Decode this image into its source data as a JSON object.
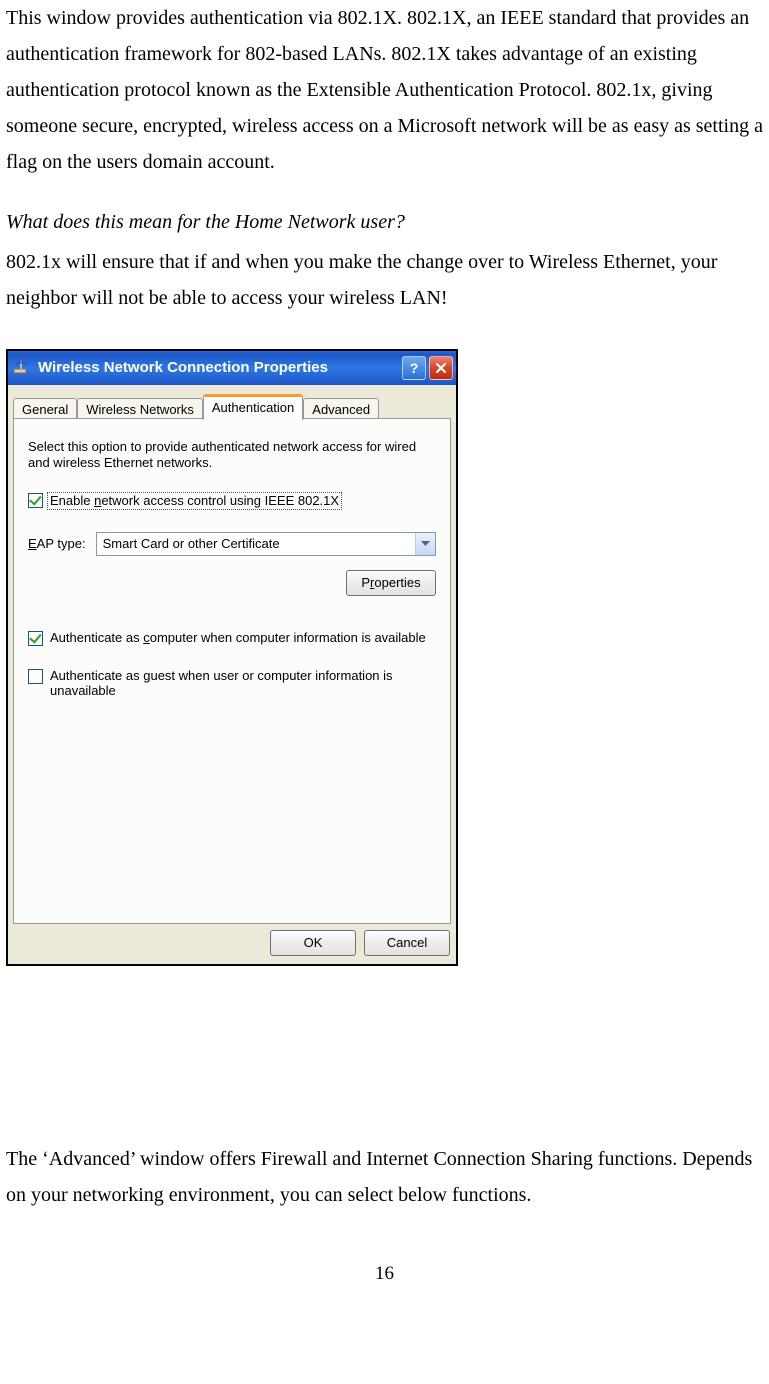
{
  "doc": {
    "para1": "This window provides authentication via 802.1X. 802.1X, an IEEE standard that provides an authentication framework for 802-based LANs. 802.1X takes advantage of an existing authentication protocol known as the Extensible Authentication Protocol. 802.1x, giving someone secure, encrypted, wireless access on a Microsoft network will be as easy as setting a flag on the users domain account.",
    "question": "What does this mean for the Home Network user?",
    "para2": "802.1x will ensure that if and when you make the change over to Wireless Ethernet, your neighbor will not be able to access your wireless LAN!",
    "para3": "The ‘Advanced’ window offers Firewall and Internet Connection Sharing functions. Depends on your networking environment, you can select below functions.",
    "page_number": "16"
  },
  "dialog": {
    "title": "Wireless Network Connection Properties",
    "tabs": {
      "general": "General",
      "wireless": "Wireless Networks",
      "auth": "Authentication",
      "advanced": "Advanced"
    },
    "description": "Select this option to provide authenticated network access for wired and wireless Ethernet networks.",
    "checkbox_enable_pre": "Enable ",
    "checkbox_enable_u": "n",
    "checkbox_enable_post": "etwork access control using IEEE 802.1X",
    "eap_label_u": "E",
    "eap_label_post": "AP type:",
    "eap_value": "Smart Card or other Certificate",
    "properties_btn_pre": "P",
    "properties_btn_u": "r",
    "properties_btn_post": "operties",
    "checkbox_computer_pre": "Authenticate as ",
    "checkbox_computer_u": "c",
    "checkbox_computer_post": "omputer when computer information is available",
    "checkbox_guest_pre": "Authenticate as ",
    "checkbox_guest_u": "g",
    "checkbox_guest_post": "uest when user or computer information is unavailable",
    "ok": "OK",
    "cancel": "Cancel"
  }
}
